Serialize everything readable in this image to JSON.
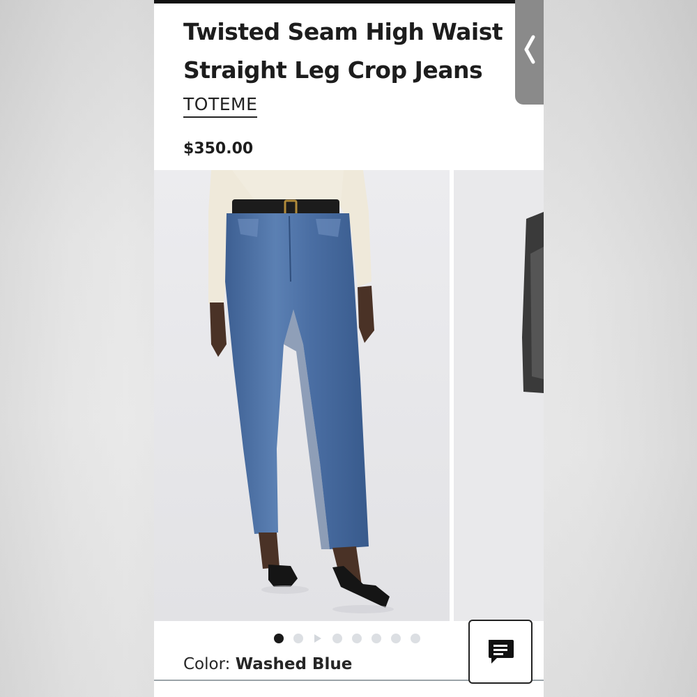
{
  "product": {
    "title_line1": "Twisted Seam High Waist",
    "title_line2": "Straight Leg Crop Jeans",
    "brand": "TOTEME",
    "price": "$350.00"
  },
  "navigation": {
    "back_icon": "chevron-left-icon"
  },
  "gallery": {
    "image_count": 8,
    "active_index": 0,
    "has_video_indicator": true,
    "current_image": "model wearing washed blue straight leg crop jeans with black belt, cream top and black flats",
    "next_image": "partial view of next product photo"
  },
  "color": {
    "label": "Color:",
    "value": "Washed Blue"
  },
  "chat": {
    "icon": "chat-bubble-icon"
  },
  "colors": {
    "text": "#1d1d1d",
    "back_tab": "#8a8a8a",
    "active_dot": "#1a1a1a",
    "inactive_dot": "#dcdfe3"
  }
}
